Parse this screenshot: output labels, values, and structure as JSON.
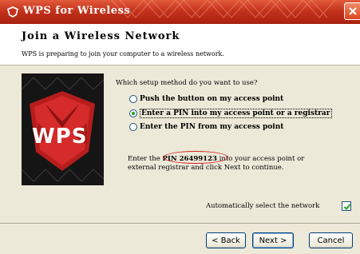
{
  "window": {
    "title": "WPS for Wireless",
    "colors": {
      "titlebar": "#c4331c",
      "panel": "#ece9d8",
      "accent_oval": "#d31e1e"
    }
  },
  "header": {
    "title": "Join a Wireless Network",
    "subtitle": "WPS is preparing to join your computer to a wireless network."
  },
  "logo": {
    "text": "WPS"
  },
  "main": {
    "question": "Which setup method do you want to use?",
    "options": [
      {
        "label": "Push the button on my access point",
        "selected": false
      },
      {
        "label": "Enter a PIN into my access point or a registrar",
        "selected": true
      },
      {
        "label": "Enter the PIN from my access point",
        "selected": false
      }
    ],
    "pin_prefix": "Enter the",
    "pin_value": "PIN 26499123",
    "pin_suffix": "into your access point or",
    "pin_line2": "external registrar and click Next to continue.",
    "auto_select_label": "Automatically select the network",
    "auto_select_checked": true
  },
  "buttons": {
    "back": "< Back",
    "next": "Next >",
    "cancel": "Cancel"
  }
}
